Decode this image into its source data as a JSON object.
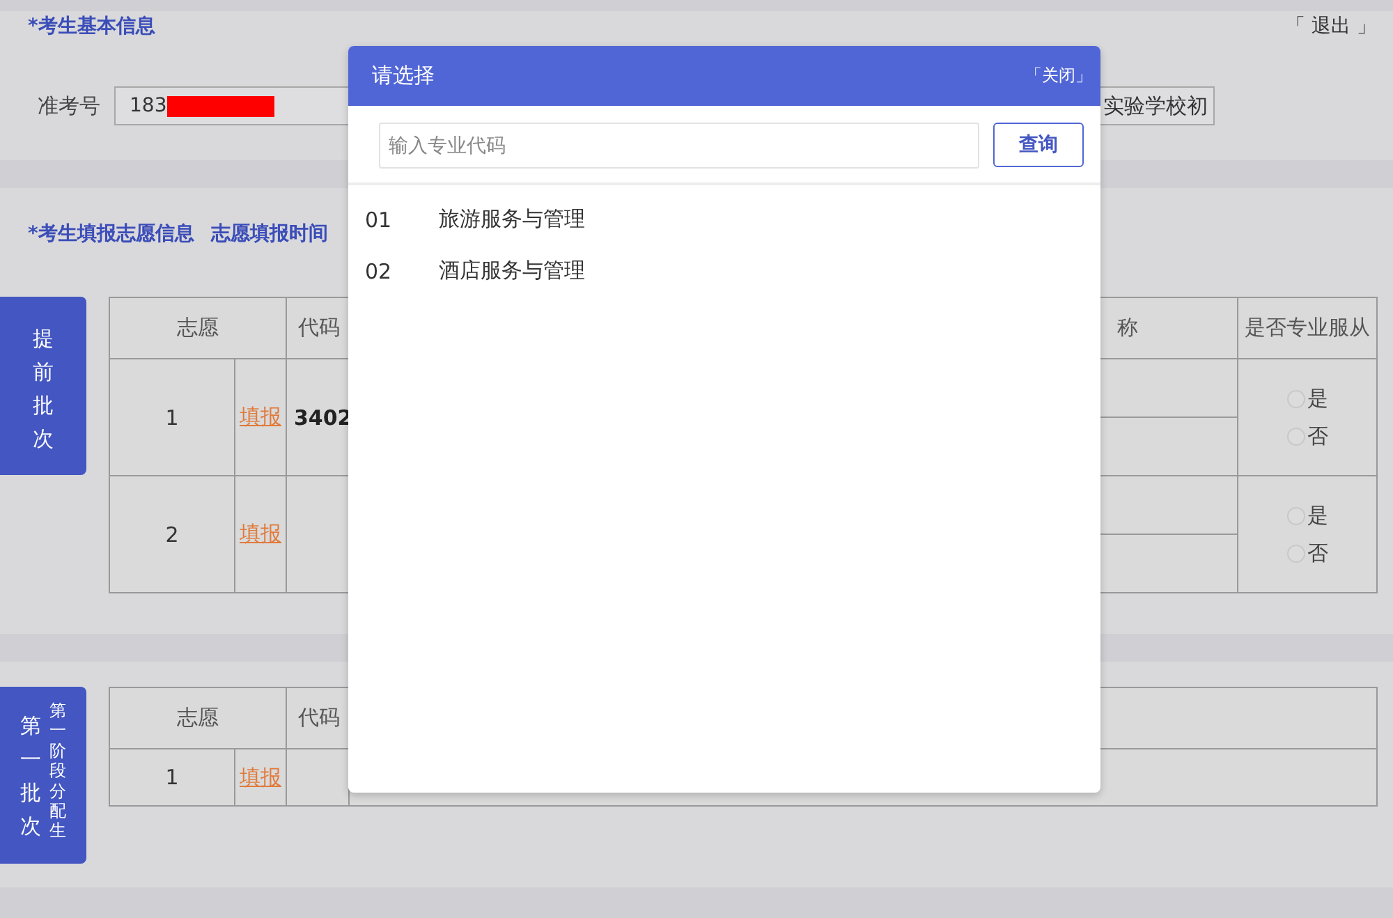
{
  "basic_info": {
    "title": "*考生基本信息",
    "logout": "「 退出 」",
    "exam_no_label": "准考号",
    "exam_no_value": "183",
    "exam_no_redacted": true,
    "school_value": "实验学校初"
  },
  "application": {
    "title": "*考生填报志愿信息",
    "time_label": "志愿填报时间"
  },
  "batches": [
    {
      "kind": "full",
      "tab_title": "提前批次",
      "columns": [
        "志愿",
        "代码",
        "称",
        "是否专业服从"
      ],
      "rows": [
        {
          "number": "1",
          "action": "填报",
          "code": "3402",
          "options": [
            {
              "label": "是",
              "checked": false
            },
            {
              "label": "否",
              "checked": false
            }
          ]
        },
        {
          "number": "2",
          "action": "填报",
          "options": [
            {
              "label": "是",
              "checked": false
            },
            {
              "label": "否",
              "checked": false
            }
          ]
        }
      ]
    },
    {
      "kind": "partial",
      "tab_title": "第一批次",
      "tab_subtitle": "第一阶段分配生",
      "columns": [
        "志愿",
        "代码"
      ],
      "rows": [
        {
          "number": "1",
          "action": "填报"
        }
      ]
    }
  ],
  "modal": {
    "title": "请选择",
    "close": "「关闭」",
    "search": {
      "placeholder": "输入专业代码"
    },
    "search_button": "查询",
    "items": [
      {
        "code": "01",
        "name": "旅游服务与管理"
      },
      {
        "code": "02",
        "name": "酒店服务与管理"
      }
    ]
  }
}
